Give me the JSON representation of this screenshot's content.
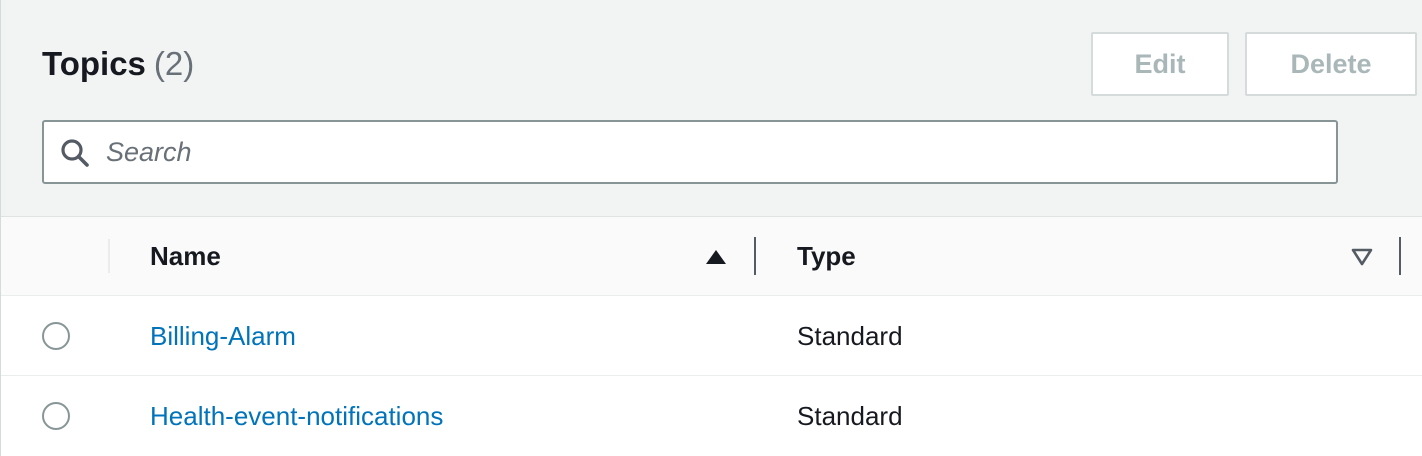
{
  "header": {
    "title": "Topics",
    "count": "(2)",
    "edit_label": "Edit",
    "delete_label": "Delete"
  },
  "search": {
    "placeholder": "Search",
    "value": ""
  },
  "table": {
    "columns": [
      {
        "label": "Name",
        "sort": "ascending"
      },
      {
        "label": "Type",
        "sort": "none"
      }
    ],
    "rows": [
      {
        "name": "Billing-Alarm",
        "type": "Standard",
        "selected": false
      },
      {
        "name": "Health-event-notifications",
        "type": "Standard",
        "selected": false
      }
    ]
  },
  "colors": {
    "link": "#0073bb",
    "header_bg": "#f2f3f3",
    "disabled_text": "#aab7b8"
  },
  "icons": {
    "search": "search-icon",
    "sort_ascending": "sort-ascending-icon",
    "sort_descending": "sort-descending-icon"
  }
}
